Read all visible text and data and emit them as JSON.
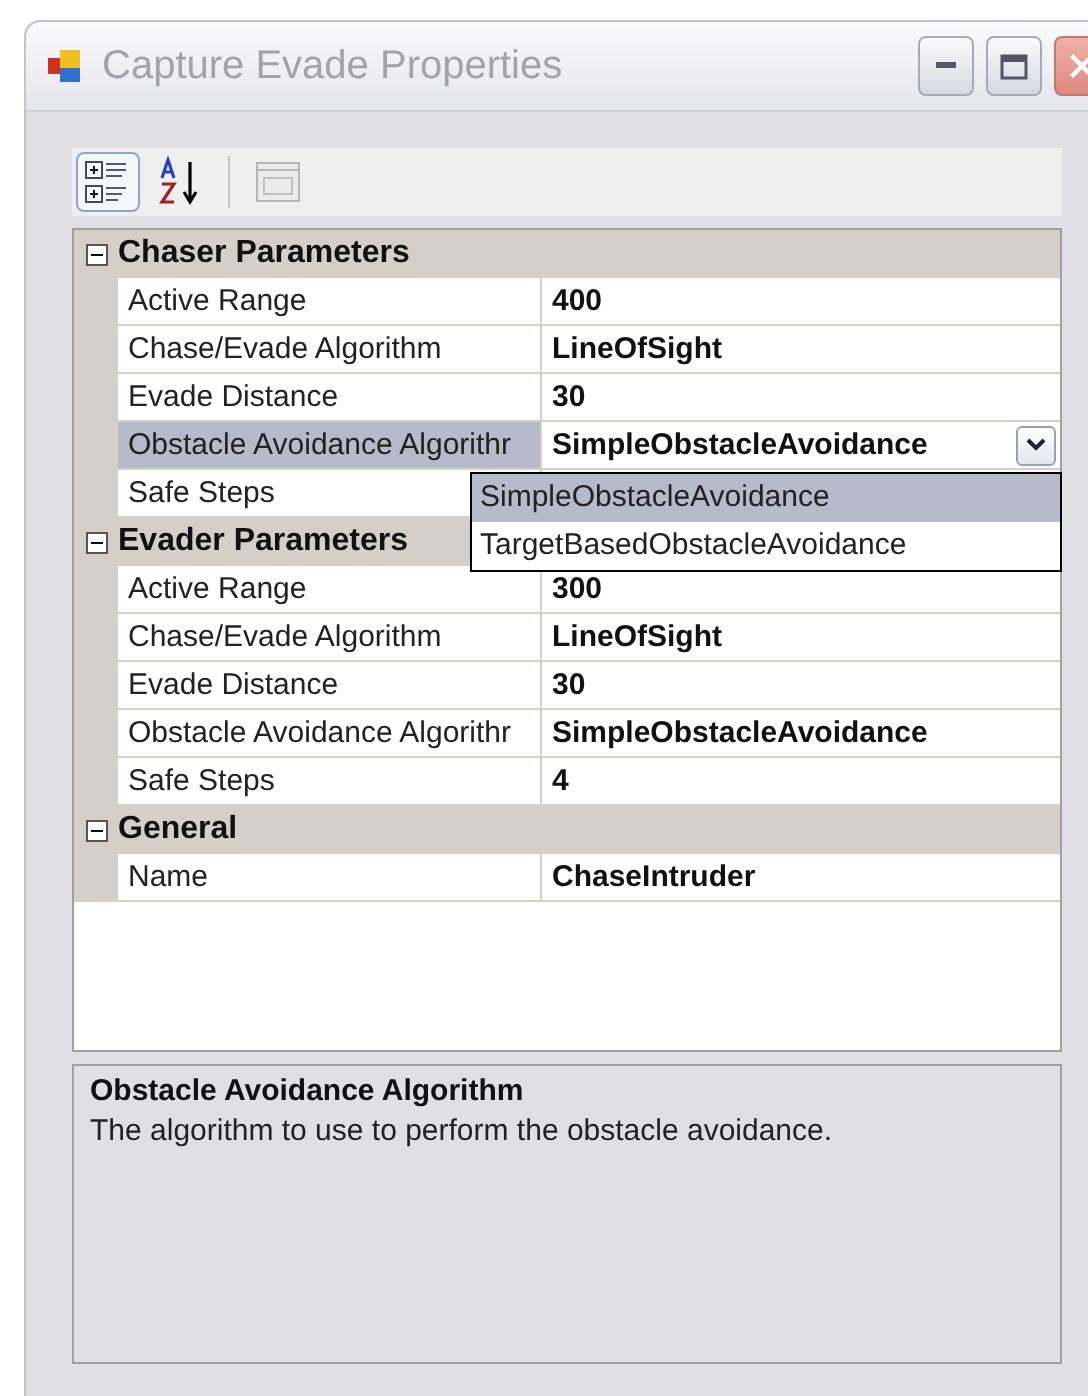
{
  "window": {
    "title": "Capture Evade Properties",
    "active": false
  },
  "toolbar": [
    {
      "kind": "categorized",
      "selected": true,
      "disabled": false
    },
    {
      "kind": "alphabetical",
      "selected": false,
      "disabled": false
    },
    {
      "kind": "property_pages",
      "selected": false,
      "disabled": true
    }
  ],
  "sections": [
    {
      "title": "Chaser Parameters",
      "expanded": true,
      "rows": [
        {
          "label": "Active Range",
          "value": "400",
          "selected": false
        },
        {
          "label": "Chase/Evade Algorithm",
          "value": "LineOfSight",
          "selected": false
        },
        {
          "label": "Evade Distance",
          "value": "30",
          "selected": false
        },
        {
          "label": "Obstacle Avoidance Algorithr",
          "value": "SimpleObstacleAvoidance",
          "selected": true,
          "dropdown": {
            "open": true,
            "items": [
              {
                "label": "SimpleObstacleAvoidance",
                "selected": true
              },
              {
                "label": "TargetBasedObstacleAvoidance",
                "selected": false
              }
            ]
          }
        },
        {
          "label": "Safe Steps",
          "selected": false
        }
      ]
    },
    {
      "title": "Evader Parameters",
      "expanded": true,
      "rows": [
        {
          "label": "Active Range",
          "value": "300",
          "selected": false
        },
        {
          "label": "Chase/Evade Algorithm",
          "value": "LineOfSight",
          "selected": false
        },
        {
          "label": "Evade Distance",
          "value": "30",
          "selected": false
        },
        {
          "label": "Obstacle Avoidance Algorithr",
          "value": "SimpleObstacleAvoidance",
          "selected": false
        },
        {
          "label": "Safe Steps",
          "value": "4",
          "selected": false
        }
      ]
    },
    {
      "title": "General",
      "expanded": true,
      "rows": [
        {
          "label": "Name",
          "value": "ChaseIntruder",
          "selected": false
        }
      ]
    }
  ],
  "description": {
    "title": "Obstacle Avoidance Algorithm",
    "text": "The algorithm to use to perform the obstacle avoidance."
  }
}
